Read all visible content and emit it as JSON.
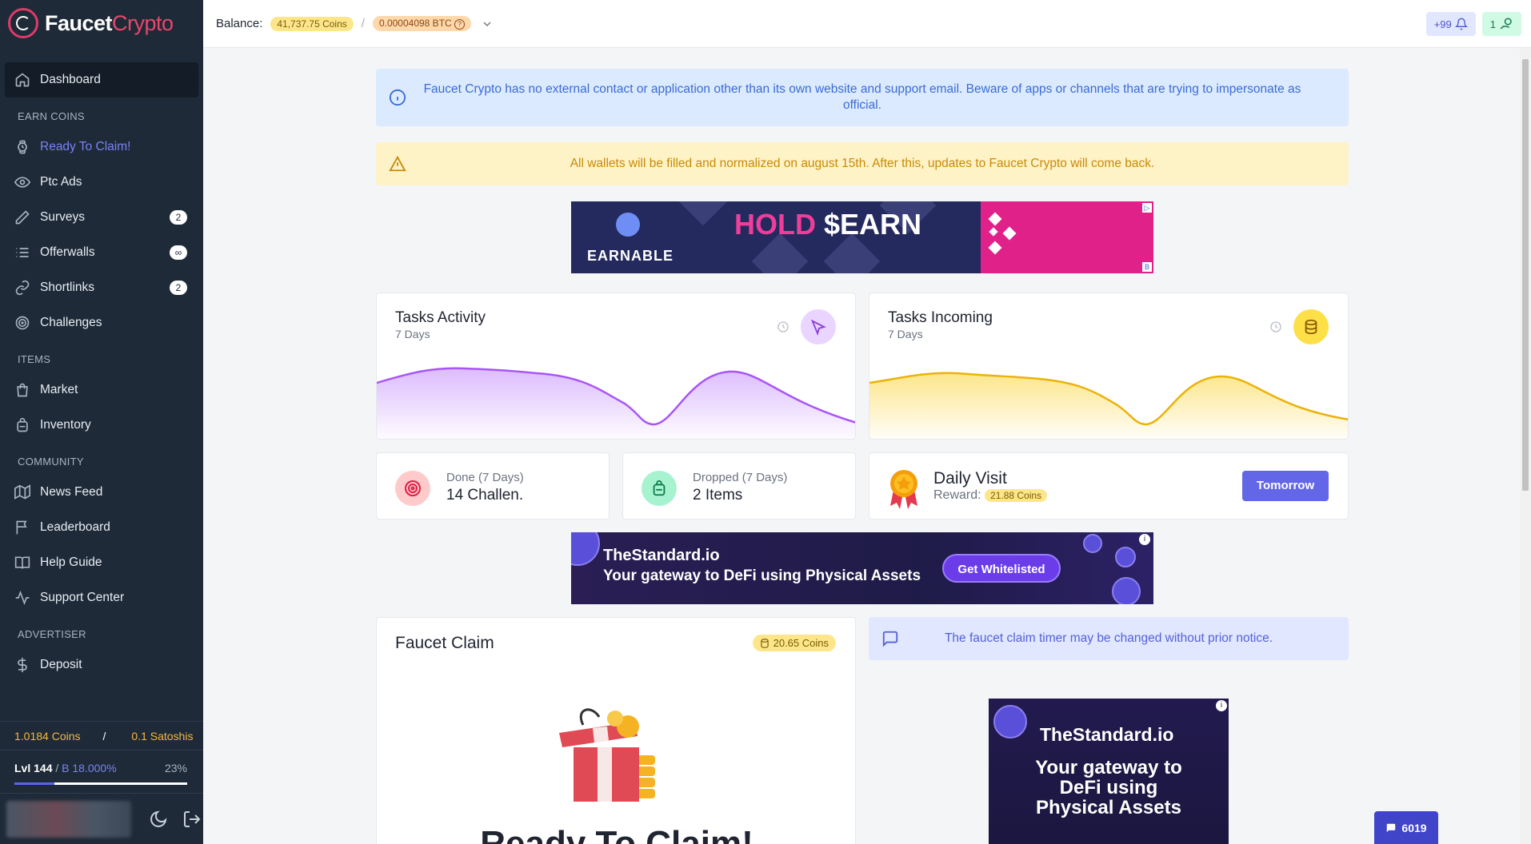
{
  "brand": {
    "name_main": "Faucet",
    "name_accent": "Crypto"
  },
  "sidebar": {
    "dashboard": "Dashboard",
    "sections": {
      "earn": "EARN COINS",
      "items": "ITEMS",
      "community": "COMMUNITY",
      "advertiser": "ADVERTISER"
    },
    "earn_items": [
      {
        "label": "Ready To Claim!",
        "icon": "watch-icon"
      },
      {
        "label": "Ptc Ads",
        "icon": "eye-icon"
      },
      {
        "label": "Surveys",
        "icon": "pencil-icon",
        "badge": "2"
      },
      {
        "label": "Offerwalls",
        "icon": "list-icon",
        "badge": "∞"
      },
      {
        "label": "Shortlinks",
        "icon": "link-icon",
        "badge": "2"
      },
      {
        "label": "Challenges",
        "icon": "target-icon"
      }
    ],
    "items_items": [
      {
        "label": "Market",
        "icon": "shopping-bag-icon"
      },
      {
        "label": "Inventory",
        "icon": "backpack-icon"
      }
    ],
    "community_items": [
      {
        "label": "News Feed",
        "icon": "map-icon"
      },
      {
        "label": "Leaderboard",
        "icon": "flag-icon"
      },
      {
        "label": "Help Guide",
        "icon": "book-icon"
      },
      {
        "label": "Support Center",
        "icon": "activity-icon"
      }
    ],
    "advertiser_items": [
      {
        "label": "Deposit",
        "icon": "dollar-icon"
      }
    ],
    "bottom": {
      "coins": "1.0184 Coins",
      "separator": "/",
      "satoshis": "0.1 Satoshis",
      "level": "Lvl 144",
      "level_sep": " / ",
      "bonus": "B 18.000%",
      "progress_text": "23%",
      "progress_fraction": 0.23
    }
  },
  "topbar": {
    "balance_label": "Balance:",
    "coins": "41,737.75 Coins",
    "separator": "/",
    "btc": "0.00004098 BTC",
    "notif_count": "+99",
    "msg_count": "1"
  },
  "alerts": {
    "info": "Faucet Crypto has no external contact or application other than its own website and support email. Beware of apps or channels that are trying to impersonate as official.",
    "warning": "All wallets will be filled and normalized on august 15th. After this, updates to Faucet Crypto will come back."
  },
  "ads": {
    "earnable": {
      "brand": "EARNABLE",
      "hold": "HOLD",
      "earn": "$EARN",
      "choice": "B"
    },
    "standard": {
      "brand": "TheStandard.io",
      "tagline": "Your gateway to DeFi using Physical Assets",
      "cta": "Get Whitelisted",
      "info": "i"
    },
    "standard_tall": {
      "brand": "TheStandard.io",
      "line1": "Your gateway to",
      "line2": "DeFi using",
      "line3": "Physical Assets",
      "info": "i"
    }
  },
  "tasks_activity": {
    "title": "Tasks Activity",
    "subtitle": "7 Days",
    "color": "#a855f7"
  },
  "tasks_incoming": {
    "title": "Tasks Incoming",
    "subtitle": "7 Days",
    "color": "#eab308"
  },
  "stats": {
    "done": {
      "label": "Done (7 Days)",
      "value": "14 Challen."
    },
    "dropped": {
      "label": "Dropped (7 Days)",
      "value": "2 Items"
    }
  },
  "daily_visit": {
    "title": "Daily Visit",
    "reward_label": "Reward:",
    "reward": "21.88 Coins",
    "button": "Tomorrow"
  },
  "faucet": {
    "title": "Faucet Claim",
    "coins": "20.65 Coins",
    "status": "Ready To Claim!"
  },
  "notice": "The faucet claim timer may be changed without prior notice.",
  "chat": {
    "count": "6019"
  },
  "colors": {
    "sidebar_bg": "#1e2a38",
    "accent": "#6366e6",
    "brand_pink": "#e8486b"
  }
}
